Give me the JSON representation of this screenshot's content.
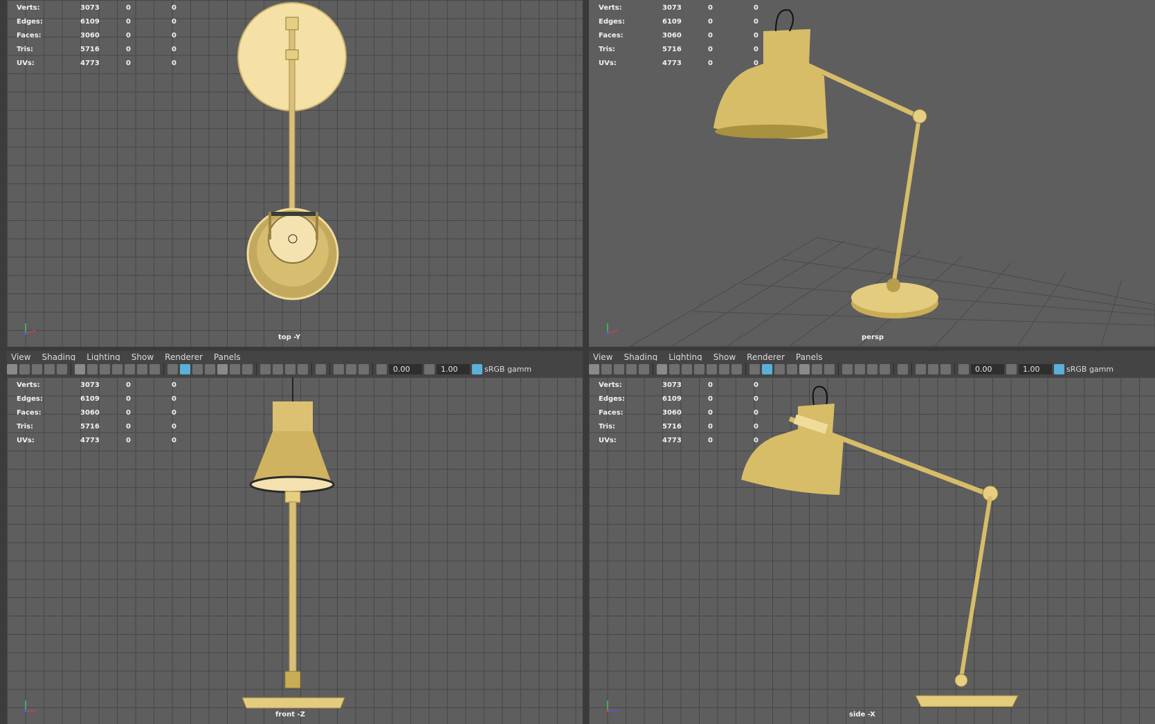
{
  "stats": [
    {
      "label": "Verts:",
      "value": "3073",
      "c1": "0",
      "c2": "0"
    },
    {
      "label": "Edges:",
      "value": "6109",
      "c1": "0",
      "c2": "0"
    },
    {
      "label": "Faces:",
      "value": "3060",
      "c1": "0",
      "c2": "0"
    },
    {
      "label": "Tris:",
      "value": "5716",
      "c1": "0",
      "c2": "0"
    },
    {
      "label": "UVs:",
      "value": "4773",
      "c1": "0",
      "c2": "0"
    }
  ],
  "views": {
    "top": "top -Y",
    "persp": "persp",
    "front": "front -Z",
    "side": "side -X"
  },
  "menu": {
    "view": "View",
    "shading": "Shading",
    "lighting": "Lighting",
    "show": "Show",
    "renderer": "Renderer",
    "panels": "Panels"
  },
  "toolbar": {
    "exposure": "0.00",
    "gamma": "1.00",
    "colorspace": "sRGB gamm"
  },
  "colors": {
    "lamp": "#e6cf82",
    "lamp_dark": "#b8a050",
    "bg": "#5e5e5e",
    "grid": "#474747"
  }
}
